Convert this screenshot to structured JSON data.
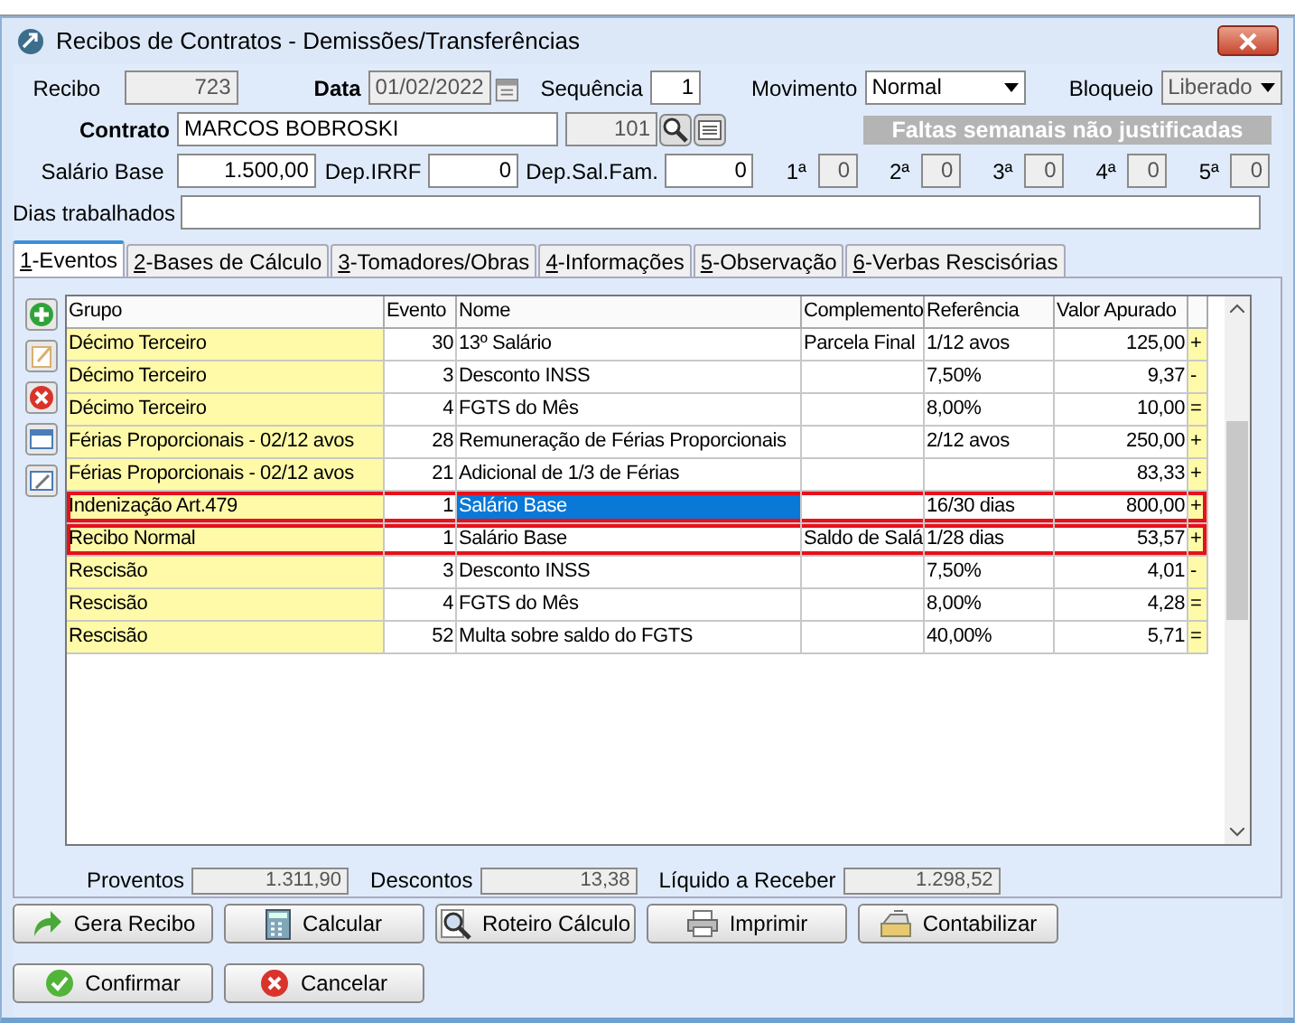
{
  "window": {
    "title": "Recibos de Contratos - Demissões/Transferências"
  },
  "form": {
    "recibo": {
      "label": "Recibo",
      "value": "723"
    },
    "data": {
      "label": "Data",
      "value": "01/02/2022"
    },
    "sequencia": {
      "label": "Sequência",
      "value": "1"
    },
    "movimento": {
      "label": "Movimento",
      "value": "Normal"
    },
    "bloqueio": {
      "label": "Bloqueio",
      "value": "Liberado"
    },
    "contrato": {
      "label": "Contrato",
      "value": "MARCOS BOBROSKI",
      "number": "101"
    },
    "salario_base": {
      "label": "Salário Base",
      "value": "1.500,00"
    },
    "dep_irrf": {
      "label": "Dep.IRRF",
      "value": "0"
    },
    "dep_sal_fam": {
      "label": "Dep.Sal.Fam.",
      "value": "0"
    },
    "faltas": {
      "title": "Faltas semanais não justificadas",
      "weeks": [
        {
          "label": "1ª",
          "value": "0"
        },
        {
          "label": "2ª",
          "value": "0"
        },
        {
          "label": "3ª",
          "value": "0"
        },
        {
          "label": "4ª",
          "value": "0"
        },
        {
          "label": "5ª",
          "value": "0"
        }
      ]
    },
    "dias_trabalhados": {
      "label": "Dias trabalhados"
    }
  },
  "tabs": [
    {
      "label": "1-Eventos",
      "selected": true
    },
    {
      "label": "2-Bases de Cálculo",
      "selected": false
    },
    {
      "label": "3-Tomadores/Obras",
      "selected": false
    },
    {
      "label": "4-Informações",
      "selected": false
    },
    {
      "label": "5-Observação",
      "selected": false
    },
    {
      "label": "6-Verbas Rescisórias",
      "selected": false
    }
  ],
  "table": {
    "columns": [
      "Grupo",
      "Evento",
      "Nome",
      "Complemento",
      "Referência",
      "Valor Apurado"
    ],
    "rows": [
      {
        "grupo": "Décimo Terceiro",
        "evento": "30",
        "nome": "13º Salário",
        "complemento": "Parcela Final",
        "referencia": "1/12 avos",
        "valor": "125,00",
        "sinal": "+",
        "selected": false,
        "highlighted": false
      },
      {
        "grupo": "Décimo Terceiro",
        "evento": "3",
        "nome": "Desconto INSS",
        "complemento": "",
        "referencia": "7,50%",
        "valor": "9,37",
        "sinal": "-",
        "selected": false,
        "highlighted": false
      },
      {
        "grupo": "Décimo Terceiro",
        "evento": "4",
        "nome": "FGTS do Mês",
        "complemento": "",
        "referencia": "8,00%",
        "valor": "10,00",
        "sinal": "=",
        "selected": false,
        "highlighted": false
      },
      {
        "grupo": "Férias Proporcionais - 02/12 avos",
        "evento": "28",
        "nome": "Remuneração de Férias Proporcionais",
        "complemento": "",
        "referencia": "2/12 avos",
        "valor": "250,00",
        "sinal": "+",
        "selected": false,
        "highlighted": false
      },
      {
        "grupo": "Férias Proporcionais - 02/12 avos",
        "evento": "21",
        "nome": "Adicional de 1/3 de Férias",
        "complemento": "",
        "referencia": "",
        "valor": "83,33",
        "sinal": "+",
        "selected": false,
        "highlighted": false
      },
      {
        "grupo": "Indenização Art.479",
        "evento": "1",
        "nome": "Salário Base",
        "complemento": "",
        "referencia": "16/30 dias",
        "valor": "800,00",
        "sinal": "+",
        "selected": true,
        "highlighted": true
      },
      {
        "grupo": "Recibo Normal",
        "evento": "1",
        "nome": "Salário Base",
        "complemento": "Saldo de Salá",
        "referencia": "1/28 dias",
        "valor": "53,57",
        "sinal": "+",
        "selected": false,
        "highlighted": true
      },
      {
        "grupo": "Rescisão",
        "evento": "3",
        "nome": "Desconto INSS",
        "complemento": "",
        "referencia": "7,50%",
        "valor": "4,01",
        "sinal": "-",
        "selected": false,
        "highlighted": false
      },
      {
        "grupo": "Rescisão",
        "evento": "4",
        "nome": "FGTS do Mês",
        "complemento": "",
        "referencia": "8,00%",
        "valor": "4,28",
        "sinal": "=",
        "selected": false,
        "highlighted": false
      },
      {
        "grupo": "Rescisão",
        "evento": "52",
        "nome": "Multa sobre saldo do FGTS",
        "complemento": "",
        "referencia": "40,00%",
        "valor": "5,71",
        "sinal": "=",
        "selected": false,
        "highlighted": false
      }
    ]
  },
  "totals": [
    {
      "label": "Proventos",
      "value": "1.311,90"
    },
    {
      "label": "Descontos",
      "value": "13,38"
    },
    {
      "label": "Líquido a Receber",
      "value": "1.298,52"
    }
  ],
  "actions": [
    {
      "label": "Gera Recibo",
      "kind": "arrow"
    },
    {
      "label": "Calcular",
      "kind": "calculator"
    },
    {
      "label": "Roteiro Cálculo",
      "kind": "search"
    },
    {
      "label": "Imprimir",
      "kind": "printer"
    },
    {
      "label": "Contabilizar",
      "kind": "register"
    }
  ],
  "dialog_buttons": [
    {
      "label": "Confirmar",
      "kind": "ok"
    },
    {
      "label": "Cancelar",
      "kind": "cancel"
    }
  ]
}
